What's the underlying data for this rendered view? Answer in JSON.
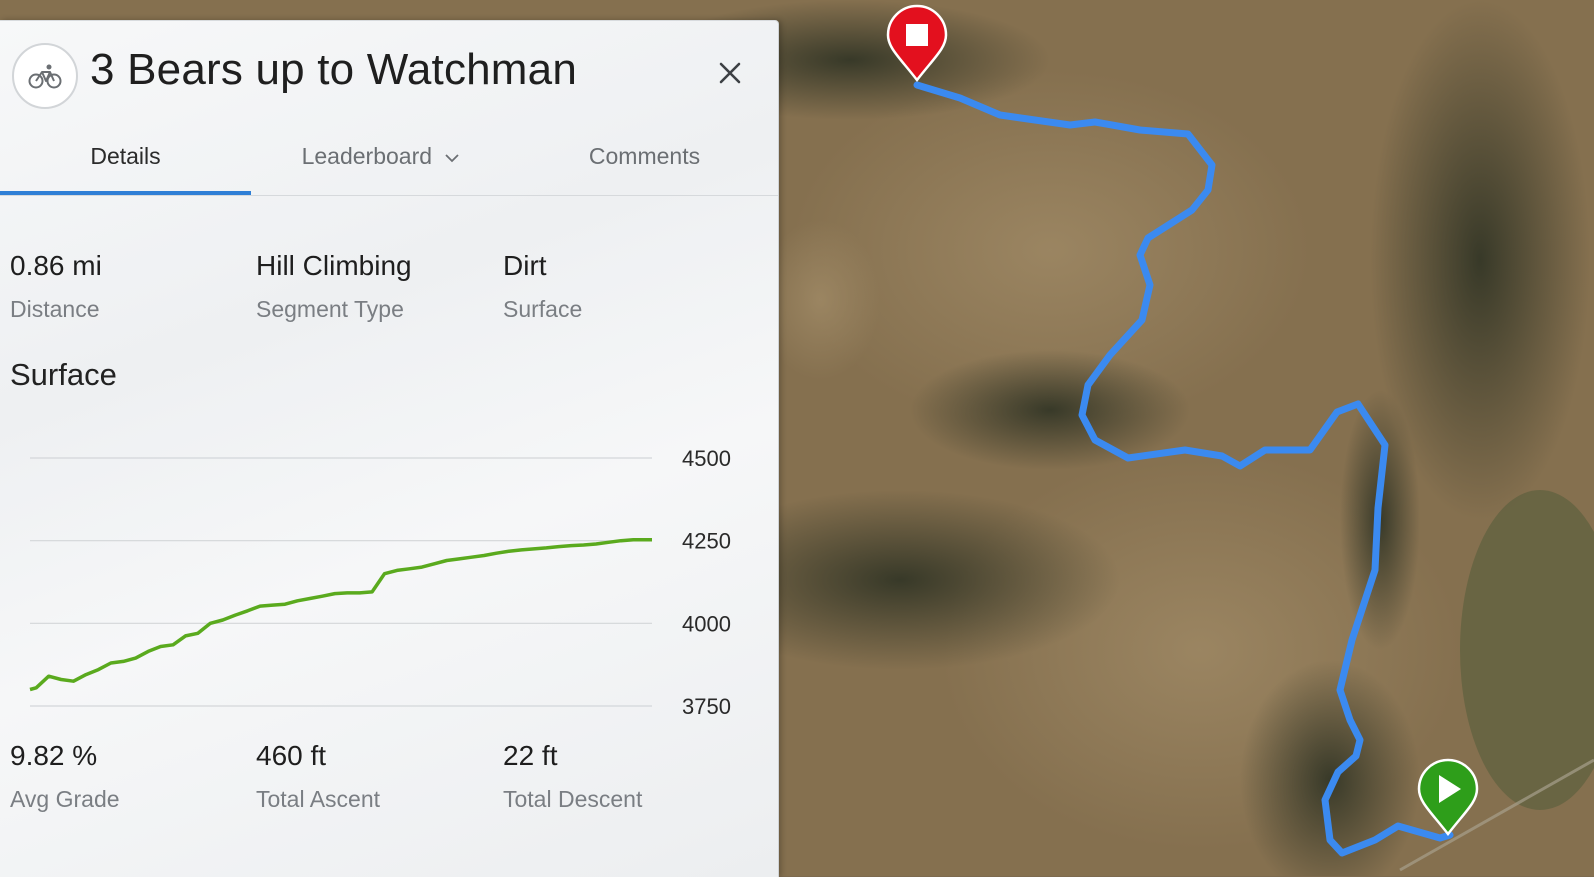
{
  "segment": {
    "title": "3 Bears up to Watchman",
    "sport_icon": "bike-icon",
    "close_icon": "close-icon"
  },
  "tabs": [
    {
      "label": "Details",
      "active": true
    },
    {
      "label": "Leaderboard",
      "dropdown": true
    },
    {
      "label": "Comments"
    }
  ],
  "stats_top": [
    {
      "value": "0.86 mi",
      "label": "Distance"
    },
    {
      "value": "Hill Climbing",
      "label": "Segment Type"
    },
    {
      "value": "Dirt",
      "label": "Surface"
    }
  ],
  "section_title": "Surface",
  "stats_bottom": [
    {
      "value": "9.82 %",
      "label": "Avg Grade"
    },
    {
      "value": "460 ft",
      "label": "Total Ascent"
    },
    {
      "value": "22 ft",
      "label": "Total Descent"
    }
  ],
  "chart_data": {
    "type": "line",
    "title": "",
    "xlabel": "",
    "ylabel": "",
    "ylim": [
      3750,
      4500
    ],
    "yticks": [
      3750,
      4000,
      4250,
      4500
    ],
    "y_axis_position": "right",
    "grid": true,
    "series": [
      {
        "color": "#5aaa1e",
        "x": [
          0,
          0.01,
          0.03,
          0.05,
          0.07,
          0.09,
          0.11,
          0.13,
          0.15,
          0.17,
          0.19,
          0.21,
          0.23,
          0.25,
          0.27,
          0.29,
          0.31,
          0.33,
          0.35,
          0.37,
          0.39,
          0.41,
          0.43,
          0.45,
          0.47,
          0.49,
          0.51,
          0.53,
          0.55,
          0.57,
          0.59,
          0.61,
          0.63,
          0.65,
          0.67,
          0.69,
          0.71,
          0.73,
          0.75,
          0.77,
          0.79,
          0.81,
          0.83,
          0.85,
          0.87,
          0.89,
          0.91,
          0.93,
          0.95,
          0.97,
          1.0
        ],
        "y": [
          3800,
          3805,
          3840,
          3830,
          3825,
          3845,
          3860,
          3880,
          3885,
          3895,
          3915,
          3930,
          3935,
          3962,
          3970,
          4000,
          4010,
          4025,
          4038,
          4052,
          4055,
          4058,
          4068,
          4075,
          4082,
          4090,
          4092,
          4092,
          4095,
          4150,
          4160,
          4165,
          4170,
          4180,
          4190,
          4195,
          4200,
          4205,
          4212,
          4218,
          4222,
          4225,
          4228,
          4232,
          4235,
          4237,
          4240,
          4245,
          4250,
          4253,
          4253
        ]
      }
    ]
  },
  "map": {
    "route_color": "#3b8af0",
    "start_marker_color": "#2e9e1a",
    "end_marker_color": "#e3101e"
  }
}
